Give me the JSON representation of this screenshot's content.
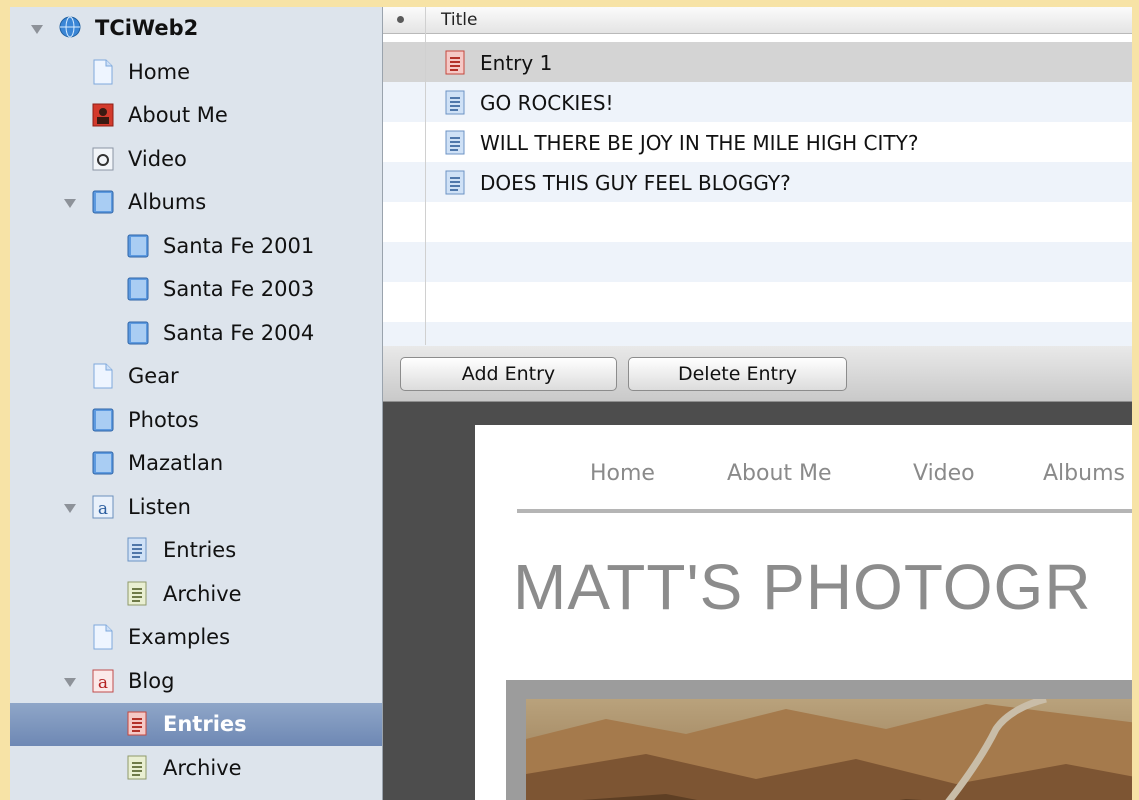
{
  "sidebar": {
    "items": [
      {
        "label": "TCiWeb2",
        "level": 0,
        "expanded": true,
        "icon": "globe-icon",
        "bold": true,
        "selected": false
      },
      {
        "label": "Home",
        "level": 1,
        "icon": "page-icon",
        "selected": false
      },
      {
        "label": "About Me",
        "level": 1,
        "icon": "about-me-icon",
        "selected": false
      },
      {
        "label": "Video",
        "level": 1,
        "icon": "video-icon",
        "selected": false
      },
      {
        "label": "Albums",
        "level": 1,
        "expanded": true,
        "icon": "album-icon",
        "selected": false
      },
      {
        "label": "Santa Fe 2001",
        "level": 2,
        "icon": "album-icon",
        "selected": false
      },
      {
        "label": "Santa Fe 2003",
        "level": 2,
        "icon": "album-icon",
        "selected": false
      },
      {
        "label": "Santa Fe 2004",
        "level": 2,
        "icon": "album-icon",
        "selected": false
      },
      {
        "label": "Gear",
        "level": 1,
        "icon": "page-icon",
        "selected": false
      },
      {
        "label": "Photos",
        "level": 1,
        "icon": "album-icon",
        "selected": false
      },
      {
        "label": "Mazatlan",
        "level": 1,
        "icon": "album-icon",
        "selected": false
      },
      {
        "label": "Listen",
        "level": 1,
        "expanded": true,
        "icon": "blog-icon-blue",
        "selected": false
      },
      {
        "label": "Entries",
        "level": 2,
        "icon": "entries-icon-blue",
        "selected": false
      },
      {
        "label": "Archive",
        "level": 2,
        "icon": "archive-icon",
        "selected": false
      },
      {
        "label": "Examples",
        "level": 1,
        "icon": "page-icon",
        "selected": false
      },
      {
        "label": "Blog",
        "level": 1,
        "expanded": true,
        "icon": "blog-icon-red",
        "selected": false
      },
      {
        "label": "Entries",
        "level": 2,
        "icon": "entries-icon-red",
        "selected": true
      },
      {
        "label": "Archive",
        "level": 2,
        "icon": "archive-icon",
        "selected": false
      }
    ]
  },
  "list": {
    "header_title": "Title",
    "rows": [
      {
        "title": "Entry 1",
        "icon": "entry-icon-red",
        "selected": true
      },
      {
        "title": "GO ROCKIES!",
        "icon": "entry-icon-blue",
        "selected": false
      },
      {
        "title": "WILL THERE BE JOY IN THE MILE HIGH CITY?",
        "icon": "entry-icon-blue",
        "selected": false
      },
      {
        "title": "DOES THIS GUY FEEL BLOGGY?",
        "icon": "entry-icon-blue",
        "selected": false
      }
    ]
  },
  "buttons": {
    "add_entry": "Add Entry",
    "delete_entry": "Delete Entry"
  },
  "preview": {
    "nav": [
      "Home",
      "About Me",
      "Video",
      "Albums"
    ],
    "site_title": "MATT'S PHOTOGR"
  },
  "colors": {
    "sidebar_bg": "#dde4ec",
    "selection": "#7a93bd",
    "outer_frame": "#f7e3a6",
    "preview_bg": "#4d4d4d"
  }
}
